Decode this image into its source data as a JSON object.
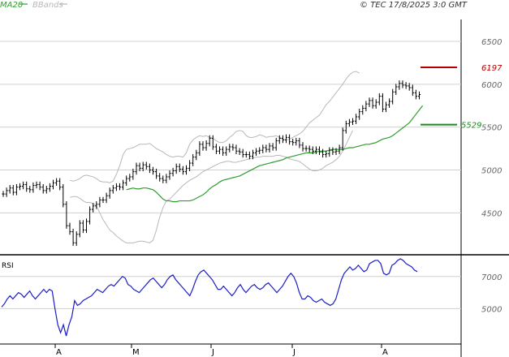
{
  "header": {
    "legend": [
      {
        "label": "MA20",
        "color": "#2e9e2e"
      },
      {
        "label": "BBands",
        "color": "#b8b8b8"
      }
    ],
    "copyright": "© TEC 17/8/2025 3:0 GMT"
  },
  "colors": {
    "candles": "#000000",
    "ma20": "#2e9e2e",
    "bbands": "#b8b8b8",
    "resistance": "#b00000",
    "support": "#1a8a1a",
    "rsi": "#1c1cc8",
    "grid": "#d0d0d0",
    "axis_text": "#666666"
  },
  "chart_data": [
    {
      "type": "ohlc",
      "title": "",
      "x_labels": [
        "A",
        "M",
        "J",
        "J",
        "A"
      ],
      "y_ticks": [
        4500,
        5000,
        5500,
        6000,
        6500
      ],
      "y_tick_labels": [
        "4500",
        "5000",
        "5500",
        "6000",
        "6500"
      ],
      "ylim": [
        4030,
        6850
      ],
      "grid": true,
      "levels": [
        {
          "name": "resistance",
          "label": "6197",
          "value": 6197,
          "color": "#b00000"
        },
        {
          "name": "support",
          "label": "5529",
          "value": 5529,
          "color": "#1a8a1a"
        }
      ],
      "close": [
        4720,
        4760,
        4790,
        4740,
        4800,
        4810,
        4830,
        4780,
        4770,
        4820,
        4830,
        4800,
        4760,
        4780,
        4810,
        4850,
        4870,
        4800,
        4600,
        4350,
        4280,
        4150,
        4250,
        4380,
        4300,
        4400,
        4540,
        4580,
        4600,
        4650,
        4650,
        4700,
        4760,
        4790,
        4810,
        4800,
        4850,
        4900,
        4920,
        4980,
        5050,
        5020,
        5060,
        5040,
        5000,
        4980,
        4930,
        4900,
        4880,
        4920,
        4960,
        4990,
        5040,
        5010,
        4980,
        5020,
        5080,
        5150,
        5200,
        5300,
        5260,
        5310,
        5370,
        5270,
        5220,
        5240,
        5200,
        5240,
        5270,
        5260,
        5220,
        5210,
        5180,
        5180,
        5160,
        5200,
        5220,
        5230,
        5260,
        5240,
        5280,
        5260,
        5340,
        5370,
        5350,
        5380,
        5330,
        5320,
        5340,
        5290,
        5250,
        5250,
        5240,
        5220,
        5240,
        5210,
        5180,
        5190,
        5230,
        5210,
        5220,
        5260,
        5460,
        5540,
        5560,
        5570,
        5620,
        5680,
        5720,
        5770,
        5810,
        5750,
        5790,
        5860,
        5710,
        5760,
        5800,
        5910,
        5970,
        6010,
        5990,
        5980,
        5960,
        5900,
        5860,
        5880
      ],
      "ma20": [
        4770,
        4780,
        4790,
        4780,
        4780,
        4790,
        4790,
        4780,
        4770,
        4740,
        4700,
        4660,
        4640,
        4640,
        4630,
        4630,
        4640,
        4640,
        4640,
        4640,
        4650,
        4670,
        4690,
        4710,
        4740,
        4780,
        4810,
        4830,
        4860,
        4880,
        4890,
        4900,
        4910,
        4920,
        4930,
        4950,
        4970,
        4990,
        5010,
        5030,
        5050,
        5060,
        5070,
        5080,
        5090,
        5100,
        5110,
        5120,
        5140,
        5150,
        5160,
        5170,
        5180,
        5190,
        5200,
        5200,
        5200,
        5210,
        5220,
        5220,
        5220,
        5230,
        5240,
        5240,
        5240,
        5240,
        5250,
        5260,
        5260,
        5270,
        5280,
        5290,
        5300,
        5300,
        5310,
        5320,
        5340,
        5360,
        5370,
        5380,
        5400,
        5430,
        5460,
        5490,
        5520,
        5550,
        5600,
        5650,
        5700,
        5750
      ],
      "ma20_start": 0,
      "bb_upper": [
        4880,
        4870,
        4880,
        4900,
        4930,
        4940,
        4930,
        4920,
        4900,
        4870,
        4860,
        4860,
        4850,
        4870,
        4950,
        5050,
        5180,
        5240,
        5250,
        5260,
        5280,
        5300,
        5300,
        5300,
        5310,
        5280,
        5250,
        5230,
        5210,
        5180,
        5160,
        5150,
        5160,
        5160,
        5150,
        5200,
        5300,
        5350,
        5380,
        5400,
        5390,
        5400,
        5380,
        5370,
        5340,
        5320,
        5320,
        5340,
        5380,
        5410,
        5450,
        5460,
        5450,
        5400,
        5380,
        5380,
        5390,
        5410,
        5400,
        5380,
        5390,
        5390,
        5400,
        5380,
        5360,
        5350,
        5360,
        5380,
        5400,
        5420,
        5450,
        5500,
        5550,
        5580,
        5610,
        5640,
        5700,
        5760,
        5800,
        5850,
        5900,
        5950,
        6000,
        6060,
        6110,
        6140,
        6150,
        6130
      ],
      "bb_lower": [
        4680,
        4690,
        4690,
        4670,
        4640,
        4620,
        4620,
        4610,
        4580,
        4500,
        4420,
        4360,
        4300,
        4270,
        4230,
        4200,
        4170,
        4150,
        4150,
        4150,
        4160,
        4170,
        4170,
        4160,
        4150,
        4180,
        4300,
        4450,
        4560,
        4640,
        4660,
        4700,
        4740,
        4780,
        4820,
        4850,
        4880,
        4900,
        4920,
        4950,
        4980,
        5000,
        5020,
        5040,
        5060,
        5080,
        5090,
        5100,
        5100,
        5090,
        5090,
        5100,
        5110,
        5120,
        5130,
        5140,
        5150,
        5150,
        5160,
        5160,
        5160,
        5160,
        5170,
        5170,
        5160,
        5150,
        5130,
        5120,
        5110,
        5100,
        5070,
        5040,
        5010,
        4990,
        4990,
        5000,
        5020,
        5050,
        5070,
        5090,
        5120,
        5160,
        5220,
        5300,
        5380,
        5460
      ],
      "bb_lower_start": 0
    },
    {
      "type": "line",
      "title": "RSI",
      "x_labels": [
        "A",
        "M",
        "J",
        "J",
        "A"
      ],
      "y_ticks": [
        50,
        70
      ],
      "y_tick_labels": [
        "5000",
        "7000"
      ],
      "ylim": [
        29,
        82
      ],
      "grid": true,
      "rsi": [
        51,
        53,
        56,
        58,
        56,
        58,
        60,
        59,
        57,
        59,
        61,
        58,
        56,
        58,
        60,
        62,
        60,
        62,
        61,
        50,
        40,
        35,
        40,
        33,
        40,
        45,
        55,
        52,
        53,
        55,
        56,
        57,
        58,
        60,
        62,
        61,
        60,
        62,
        64,
        65,
        64,
        66,
        68,
        70,
        69,
        65,
        64,
        62,
        61,
        60,
        62,
        64,
        66,
        68,
        69,
        67,
        65,
        63,
        65,
        68,
        70,
        71,
        68,
        66,
        64,
        62,
        60,
        58,
        62,
        67,
        71,
        73,
        74,
        72,
        70,
        68,
        65,
        62,
        62,
        64,
        62,
        60,
        58,
        60,
        63,
        65,
        62,
        60,
        62,
        64,
        65,
        63,
        62,
        63,
        65,
        66,
        64,
        62,
        60,
        62,
        64,
        67,
        70,
        72,
        70,
        66,
        60,
        56,
        56,
        58,
        57,
        55,
        54,
        55,
        56,
        54,
        53,
        52,
        53,
        56,
        62,
        68,
        72,
        74,
        76,
        74,
        75,
        77,
        75,
        73,
        74,
        78,
        79,
        80,
        80,
        78,
        72,
        71,
        72,
        77,
        78,
        80,
        81,
        80,
        78,
        77,
        76,
        74,
        73
      ]
    }
  ]
}
